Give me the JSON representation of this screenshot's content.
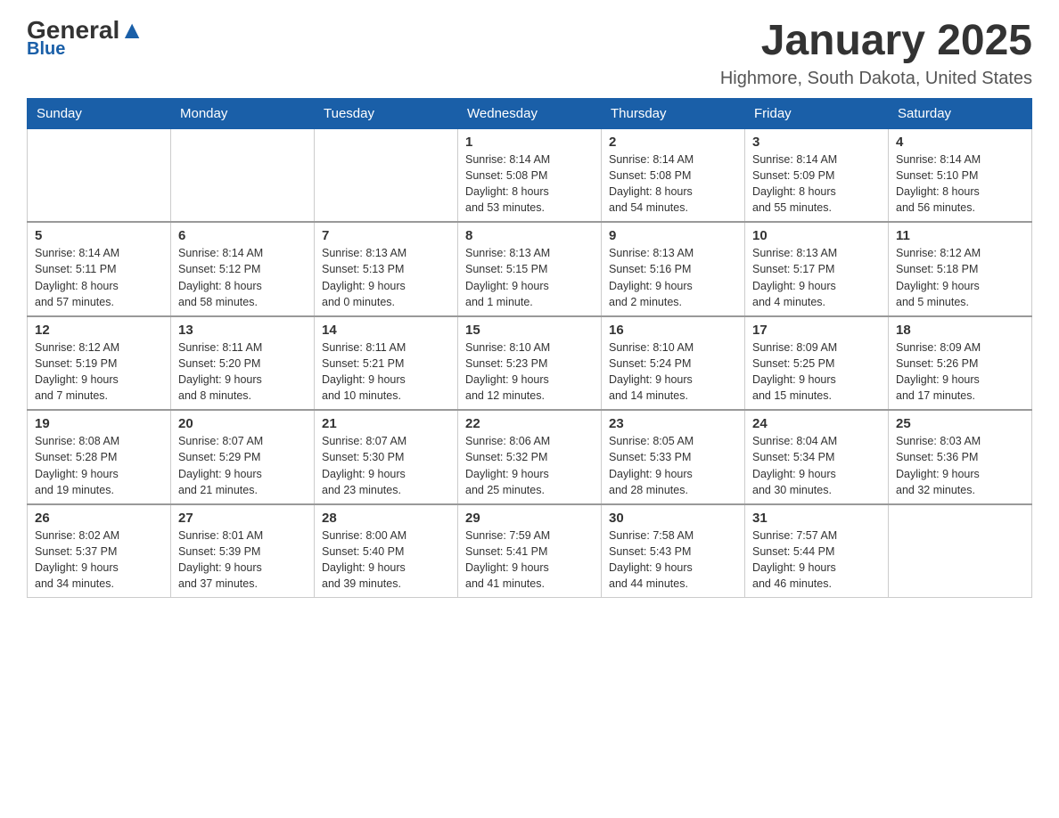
{
  "logo": {
    "general": "General",
    "blue": "Blue"
  },
  "title": "January 2025",
  "subtitle": "Highmore, South Dakota, United States",
  "days_of_week": [
    "Sunday",
    "Monday",
    "Tuesday",
    "Wednesday",
    "Thursday",
    "Friday",
    "Saturday"
  ],
  "weeks": [
    [
      {
        "day": "",
        "info": ""
      },
      {
        "day": "",
        "info": ""
      },
      {
        "day": "",
        "info": ""
      },
      {
        "day": "1",
        "info": "Sunrise: 8:14 AM\nSunset: 5:08 PM\nDaylight: 8 hours\nand 53 minutes."
      },
      {
        "day": "2",
        "info": "Sunrise: 8:14 AM\nSunset: 5:08 PM\nDaylight: 8 hours\nand 54 minutes."
      },
      {
        "day": "3",
        "info": "Sunrise: 8:14 AM\nSunset: 5:09 PM\nDaylight: 8 hours\nand 55 minutes."
      },
      {
        "day": "4",
        "info": "Sunrise: 8:14 AM\nSunset: 5:10 PM\nDaylight: 8 hours\nand 56 minutes."
      }
    ],
    [
      {
        "day": "5",
        "info": "Sunrise: 8:14 AM\nSunset: 5:11 PM\nDaylight: 8 hours\nand 57 minutes."
      },
      {
        "day": "6",
        "info": "Sunrise: 8:14 AM\nSunset: 5:12 PM\nDaylight: 8 hours\nand 58 minutes."
      },
      {
        "day": "7",
        "info": "Sunrise: 8:13 AM\nSunset: 5:13 PM\nDaylight: 9 hours\nand 0 minutes."
      },
      {
        "day": "8",
        "info": "Sunrise: 8:13 AM\nSunset: 5:15 PM\nDaylight: 9 hours\nand 1 minute."
      },
      {
        "day": "9",
        "info": "Sunrise: 8:13 AM\nSunset: 5:16 PM\nDaylight: 9 hours\nand 2 minutes."
      },
      {
        "day": "10",
        "info": "Sunrise: 8:13 AM\nSunset: 5:17 PM\nDaylight: 9 hours\nand 4 minutes."
      },
      {
        "day": "11",
        "info": "Sunrise: 8:12 AM\nSunset: 5:18 PM\nDaylight: 9 hours\nand 5 minutes."
      }
    ],
    [
      {
        "day": "12",
        "info": "Sunrise: 8:12 AM\nSunset: 5:19 PM\nDaylight: 9 hours\nand 7 minutes."
      },
      {
        "day": "13",
        "info": "Sunrise: 8:11 AM\nSunset: 5:20 PM\nDaylight: 9 hours\nand 8 minutes."
      },
      {
        "day": "14",
        "info": "Sunrise: 8:11 AM\nSunset: 5:21 PM\nDaylight: 9 hours\nand 10 minutes."
      },
      {
        "day": "15",
        "info": "Sunrise: 8:10 AM\nSunset: 5:23 PM\nDaylight: 9 hours\nand 12 minutes."
      },
      {
        "day": "16",
        "info": "Sunrise: 8:10 AM\nSunset: 5:24 PM\nDaylight: 9 hours\nand 14 minutes."
      },
      {
        "day": "17",
        "info": "Sunrise: 8:09 AM\nSunset: 5:25 PM\nDaylight: 9 hours\nand 15 minutes."
      },
      {
        "day": "18",
        "info": "Sunrise: 8:09 AM\nSunset: 5:26 PM\nDaylight: 9 hours\nand 17 minutes."
      }
    ],
    [
      {
        "day": "19",
        "info": "Sunrise: 8:08 AM\nSunset: 5:28 PM\nDaylight: 9 hours\nand 19 minutes."
      },
      {
        "day": "20",
        "info": "Sunrise: 8:07 AM\nSunset: 5:29 PM\nDaylight: 9 hours\nand 21 minutes."
      },
      {
        "day": "21",
        "info": "Sunrise: 8:07 AM\nSunset: 5:30 PM\nDaylight: 9 hours\nand 23 minutes."
      },
      {
        "day": "22",
        "info": "Sunrise: 8:06 AM\nSunset: 5:32 PM\nDaylight: 9 hours\nand 25 minutes."
      },
      {
        "day": "23",
        "info": "Sunrise: 8:05 AM\nSunset: 5:33 PM\nDaylight: 9 hours\nand 28 minutes."
      },
      {
        "day": "24",
        "info": "Sunrise: 8:04 AM\nSunset: 5:34 PM\nDaylight: 9 hours\nand 30 minutes."
      },
      {
        "day": "25",
        "info": "Sunrise: 8:03 AM\nSunset: 5:36 PM\nDaylight: 9 hours\nand 32 minutes."
      }
    ],
    [
      {
        "day": "26",
        "info": "Sunrise: 8:02 AM\nSunset: 5:37 PM\nDaylight: 9 hours\nand 34 minutes."
      },
      {
        "day": "27",
        "info": "Sunrise: 8:01 AM\nSunset: 5:39 PM\nDaylight: 9 hours\nand 37 minutes."
      },
      {
        "day": "28",
        "info": "Sunrise: 8:00 AM\nSunset: 5:40 PM\nDaylight: 9 hours\nand 39 minutes."
      },
      {
        "day": "29",
        "info": "Sunrise: 7:59 AM\nSunset: 5:41 PM\nDaylight: 9 hours\nand 41 minutes."
      },
      {
        "day": "30",
        "info": "Sunrise: 7:58 AM\nSunset: 5:43 PM\nDaylight: 9 hours\nand 44 minutes."
      },
      {
        "day": "31",
        "info": "Sunrise: 7:57 AM\nSunset: 5:44 PM\nDaylight: 9 hours\nand 46 minutes."
      },
      {
        "day": "",
        "info": ""
      }
    ]
  ]
}
